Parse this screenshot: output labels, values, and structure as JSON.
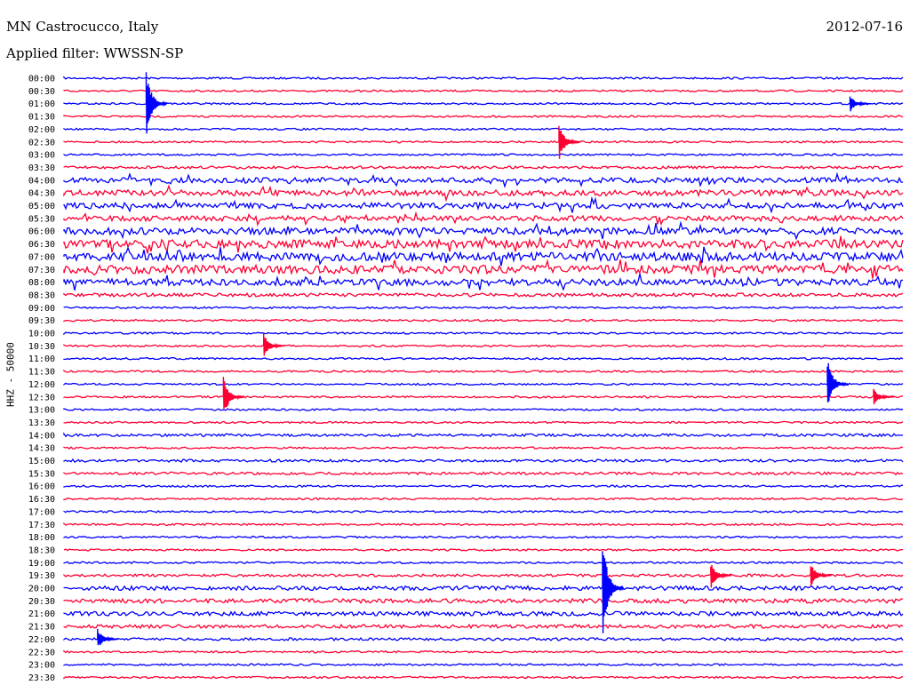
{
  "header": {
    "station": "MN Castrocucco, Italy",
    "date": "2012-07-16",
    "filter": "Applied filter: WWSSN-SP"
  },
  "chart_data": {
    "type": "line",
    "title": "MN Castrocucco, Italy",
    "ylabel": "HHZ - 50000",
    "row_labels": [
      "00:00",
      "00:30",
      "01:00",
      "01:30",
      "02:00",
      "02:30",
      "03:00",
      "03:30",
      "04:00",
      "04:30",
      "05:00",
      "05:30",
      "06:00",
      "06:30",
      "07:00",
      "07:30",
      "08:00",
      "08:30",
      "09:00",
      "09:30",
      "10:00",
      "10:30",
      "11:00",
      "11:30",
      "12:00",
      "12:30",
      "13:00",
      "13:30",
      "14:00",
      "14:30",
      "15:00",
      "15:30",
      "16:00",
      "16:30",
      "17:00",
      "17:30",
      "18:00",
      "18:30",
      "19:00",
      "19:30",
      "20:00",
      "20:30",
      "21:00",
      "21:30",
      "22:00",
      "22:30",
      "23:00",
      "23:30"
    ],
    "colors": [
      "#0000ff",
      "#ff0033"
    ],
    "trace_amplitude": [
      1,
      1,
      1,
      1,
      1,
      1,
      1,
      2,
      5,
      6,
      6,
      5,
      7,
      9,
      9,
      9,
      7,
      3,
      1,
      1,
      1,
      1,
      1,
      1,
      1,
      1,
      1,
      1,
      2,
      1,
      2,
      2,
      1,
      1,
      1,
      1,
      1,
      1,
      1,
      2,
      4,
      4,
      4,
      3,
      2,
      1,
      1,
      1
    ],
    "events": [
      {
        "row": 2,
        "position": 0.098,
        "amplitude": 40
      },
      {
        "row": 5,
        "position": 0.59,
        "amplitude": 22
      },
      {
        "row": 2,
        "position": 0.937,
        "amplitude": 10
      },
      {
        "row": 21,
        "position": 0.238,
        "amplitude": 14
      },
      {
        "row": 24,
        "position": 0.91,
        "amplitude": 30
      },
      {
        "row": 25,
        "position": 0.19,
        "amplitude": 24
      },
      {
        "row": 25,
        "position": 0.965,
        "amplitude": 10
      },
      {
        "row": 40,
        "position": 0.642,
        "amplitude": 60
      },
      {
        "row": 39,
        "position": 0.771,
        "amplitude": 16
      },
      {
        "row": 39,
        "position": 0.89,
        "amplitude": 14
      },
      {
        "row": 44,
        "position": 0.04,
        "amplitude": 12
      }
    ]
  }
}
